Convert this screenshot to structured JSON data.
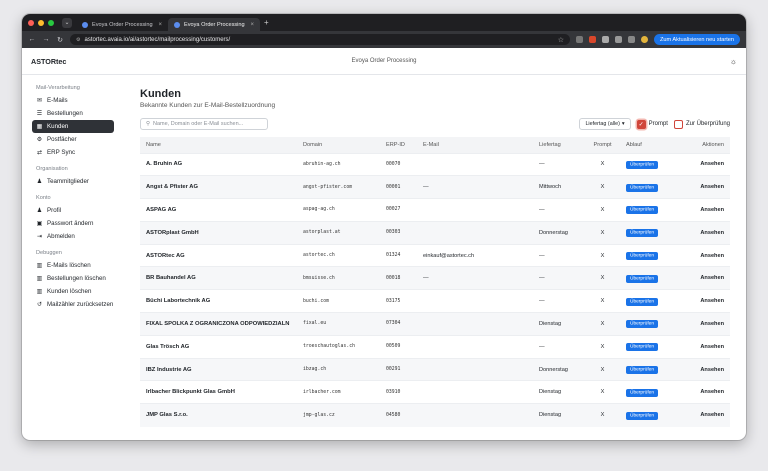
{
  "browser": {
    "tabs": [
      {
        "title": "Evoya Order Processing | Evo"
      },
      {
        "title": "Evoya Order Processing | Evo"
      }
    ],
    "url": "astortec.avaia.io/ai/astortec/mailprocessing/customers/",
    "update_label": "Zum Aktualisieren neu starten"
  },
  "app": {
    "brand": "ASTORtec",
    "title": "Evoya Order Processing"
  },
  "sidebar": {
    "sections": [
      {
        "title": "Mail-Verarbeitung",
        "items": [
          {
            "label": "E-Mails",
            "icon": "mail-icon"
          },
          {
            "label": "Bestellungen",
            "icon": "list-icon"
          },
          {
            "label": "Kunden",
            "icon": "building-icon",
            "active": true
          },
          {
            "label": "Postfächer",
            "icon": "gear-icon"
          },
          {
            "label": "ERP Sync",
            "icon": "sync-icon"
          }
        ]
      },
      {
        "title": "Organisation",
        "items": [
          {
            "label": "Teammitglieder",
            "icon": "users-icon"
          }
        ]
      },
      {
        "title": "Konto",
        "items": [
          {
            "label": "Profil",
            "icon": "user-icon"
          },
          {
            "label": "Passwort ändern",
            "icon": "lock-icon"
          },
          {
            "label": "Abmelden",
            "icon": "logout-icon"
          }
        ]
      },
      {
        "title": "Debuggen",
        "items": [
          {
            "label": "E-Mails löschen",
            "icon": "trash-icon"
          },
          {
            "label": "Bestellungen löschen",
            "icon": "trash-icon"
          },
          {
            "label": "Kunden löschen",
            "icon": "trash-icon"
          },
          {
            "label": "Mailzähler zurücksetzen",
            "icon": "reset-icon"
          }
        ]
      }
    ]
  },
  "page": {
    "title": "Kunden",
    "subtitle": "Bekannte Kunden zur E-Mail-Bestellzuordnung",
    "search_placeholder": "Name, Domain oder E-Mail suchen...",
    "filter_select": "Liefertag (alle)",
    "check_prompt": "Prompt",
    "check_review": "Zur Überprüfung"
  },
  "table": {
    "headers": [
      "Name",
      "Domain",
      "ERP-ID",
      "E-Mail",
      "Liefertag",
      "Prompt",
      "Ablauf",
      "Aktionen"
    ],
    "badge_label": "Überprüfen",
    "action_label": "Ansehen",
    "rows": [
      {
        "name": "A. Bruhin AG",
        "domain": "abruhin-ag.ch",
        "erp": "00070",
        "email": "",
        "day": "—",
        "prompt": "X"
      },
      {
        "name": "Angst & Pfister AG",
        "domain": "angst-pfister.com",
        "erp": "00001",
        "email": "—",
        "day": "Mittwoch",
        "prompt": "X"
      },
      {
        "name": "ASPAG AG",
        "domain": "aspag-ag.ch",
        "erp": "00027",
        "email": "",
        "day": "—",
        "prompt": "X"
      },
      {
        "name": "ASTORplast GmbH",
        "domain": "astorplast.at",
        "erp": "00303",
        "email": "",
        "day": "Donnerstag",
        "prompt": "X"
      },
      {
        "name": "ASTORtec AG",
        "domain": "astortec.ch",
        "erp": "01324",
        "email": "einkauf@astortec.ch",
        "day": "—",
        "prompt": "X"
      },
      {
        "name": "BR Bauhandel AG",
        "domain": "bmsuisse.ch",
        "erp": "00018",
        "email": "—",
        "day": "—",
        "prompt": "X"
      },
      {
        "name": "Büchi Labortechnik AG",
        "domain": "buchi.com",
        "erp": "03175",
        "email": "",
        "day": "—",
        "prompt": "X"
      },
      {
        "name": "FIXAL SPOLKA Z OGRANICZONA ODPOWIEDZIALN",
        "domain": "fixal.eu",
        "erp": "07304",
        "email": "",
        "day": "Dienstag",
        "prompt": "X"
      },
      {
        "name": "Glas Trösch AG",
        "domain": "troeschautoglas.ch",
        "erp": "00509",
        "email": "",
        "day": "—",
        "prompt": "X"
      },
      {
        "name": "IBZ Industrie AG",
        "domain": "ibzag.ch",
        "erp": "00291",
        "email": "",
        "day": "Donnerstag",
        "prompt": "X"
      },
      {
        "name": "Irlbacher Blickpunkt Glas GmbH",
        "domain": "irlbacher.com",
        "erp": "03910",
        "email": "",
        "day": "Dienstag",
        "prompt": "X"
      },
      {
        "name": "JMP Glas S.r.o.",
        "domain": "jmp-glas.cz",
        "erp": "04580",
        "email": "",
        "day": "Dienstag",
        "prompt": "X"
      }
    ]
  }
}
